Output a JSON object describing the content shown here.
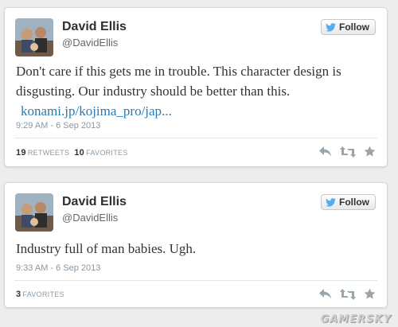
{
  "tweets": [
    {
      "name": "David Ellis",
      "handle": "@DavidEllis",
      "follow_label": "Follow",
      "text": "Don't care if this gets me in trouble. This character design is disgusting. Our industry should be better than this.",
      "link": "konami.jp/kojima_pro/jap...",
      "timestamp": "9:29 AM - 6 Sep 2013",
      "retweets_count": "19",
      "retweets_label": "RETWEETS",
      "favorites_count": "10",
      "favorites_label": "FAVORITES"
    },
    {
      "name": "David Ellis",
      "handle": "@DavidEllis",
      "follow_label": "Follow",
      "text": "Industry full of man babies. Ugh.",
      "timestamp": "9:33 AM - 6 Sep 2013",
      "favorites_count": "3",
      "favorites_label": "FAVORITES"
    }
  ],
  "watermark": "GAMERSKY",
  "icons": [
    "twitter-bird-icon",
    "reply-icon",
    "retweet-icon",
    "favorite-star-icon"
  ],
  "colors": {
    "link": "#2a7ab0",
    "twitter_blue": "#55acee",
    "meta_gray": "#8899a6"
  }
}
